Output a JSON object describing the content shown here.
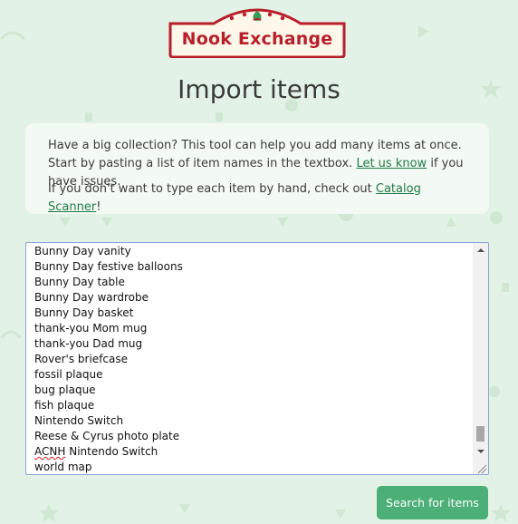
{
  "header": {
    "logo_text": "Nook Exchange"
  },
  "page": {
    "title": "Import items"
  },
  "info": {
    "paragraph1_text": "Have a big collection? This tool can help you add many items at once. Start by pasting a list of item names in the textbox.",
    "let_us_know_link": "Let us know",
    "paragraph1_suffix": "if you have issues.",
    "paragraph2_prefix": "If you don't want to type each item by hand, check out",
    "catalog_scanner_link": "Catalog Scanner",
    "paragraph2_suffix": "!"
  },
  "textarea": {
    "lines": [
      "Bunny Day vanity",
      "Bunny Day festive balloons",
      "Bunny Day table",
      "Bunny Day wardrobe",
      "Bunny Day basket",
      "thank-you Mom mug",
      "thank-you Dad mug",
      "Rover's briefcase",
      "fossil plaque",
      "bug plaque",
      "fish plaque",
      "Nintendo Switch",
      "Reese & Cyrus photo plate",
      "Nintendo Switch",
      "world map"
    ],
    "misspelled_word": "ACNH"
  },
  "actions": {
    "search_label": "Search for items"
  },
  "colors": {
    "background": "#e3f2e6",
    "brand_red": "#b81f2a",
    "button_green": "#4caf78",
    "link_green": "#1f7a46"
  }
}
